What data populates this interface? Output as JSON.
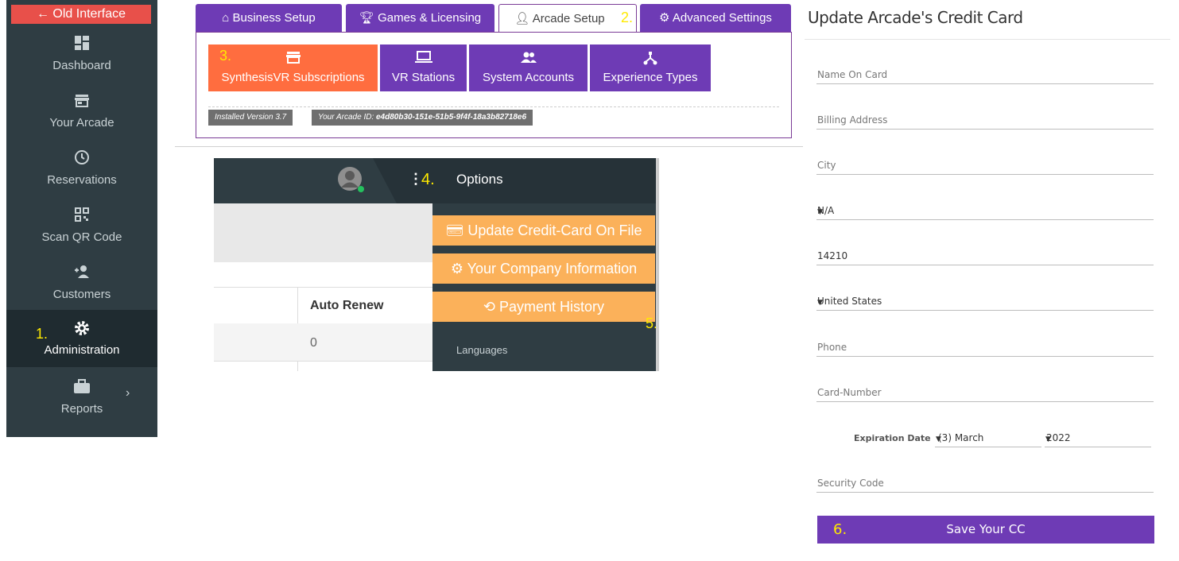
{
  "sidebar": {
    "old_interface": "← Old Interface",
    "items": [
      {
        "label": "Dashboard",
        "icon": "dashboard-icon"
      },
      {
        "label": "Your Arcade",
        "icon": "store-icon"
      },
      {
        "label": "Reservations",
        "icon": "clock-icon"
      },
      {
        "label": "Scan QR Code",
        "icon": "qr-code-icon"
      },
      {
        "label": "Customers",
        "icon": "add-user-icon"
      },
      {
        "label": "Administration",
        "icon": "gear-icon",
        "active": true,
        "step": "1."
      },
      {
        "label": "Reports",
        "icon": "briefcase-icon"
      }
    ]
  },
  "tabs": [
    {
      "label": "Business Setup",
      "icon": "home-icon"
    },
    {
      "label": "Games & Licensing",
      "icon": "trophy-icon"
    },
    {
      "label": "Arcade Setup",
      "icon": "user-icon",
      "active": true,
      "step": "2."
    },
    {
      "label": "Advanced Settings",
      "icon": "gears-icon"
    }
  ],
  "subnav": [
    {
      "label": "SynthesisVR Subscriptions",
      "icon": "store-icon",
      "step": "3."
    },
    {
      "label": "VR Stations",
      "icon": "laptop-icon"
    },
    {
      "label": "System Accounts",
      "icon": "users-icon"
    },
    {
      "label": "Experience Types",
      "icon": "sitemap-icon"
    }
  ],
  "badges": {
    "version": "Installed Version 3.7",
    "arcade_id_label": "Your Arcade ID: ",
    "arcade_id": "e4d80b30-151e-51b5-9f4f-18a3b82718e6"
  },
  "options_panel": {
    "step": "4.",
    "title": "Options",
    "buttons": [
      {
        "label": "Update Credit-Card On File",
        "icon": "credit-card-icon"
      },
      {
        "label": "Your Company Information",
        "icon": "gear-icon"
      },
      {
        "label": "Payment History",
        "icon": "history-icon"
      }
    ],
    "step5": "5.",
    "languages": "Languages",
    "table_header": "Auto Renew",
    "table_value": "0"
  },
  "form": {
    "title": "Update Arcade's Credit Card",
    "name_placeholder": "Name On Card",
    "billing_placeholder": "Billing Address",
    "city_placeholder": "City",
    "state_value": "N/A",
    "zip_value": "14210",
    "country_value": "United States",
    "phone_placeholder": "Phone",
    "card_placeholder": "Card-Number",
    "expiration_label": "Expiration Date",
    "month_value": "(3) March",
    "year_value": "2022",
    "security_placeholder": "Security Code",
    "save_step": "6.",
    "save_label": "Save Your CC"
  },
  "colors": {
    "sidebar": "#2f3d43",
    "purple": "#6e3bb5",
    "orange": "#ff6d3f",
    "options_orange": "#fbb15a",
    "red": "#e8504a",
    "step_yellow": "#ffea00"
  }
}
